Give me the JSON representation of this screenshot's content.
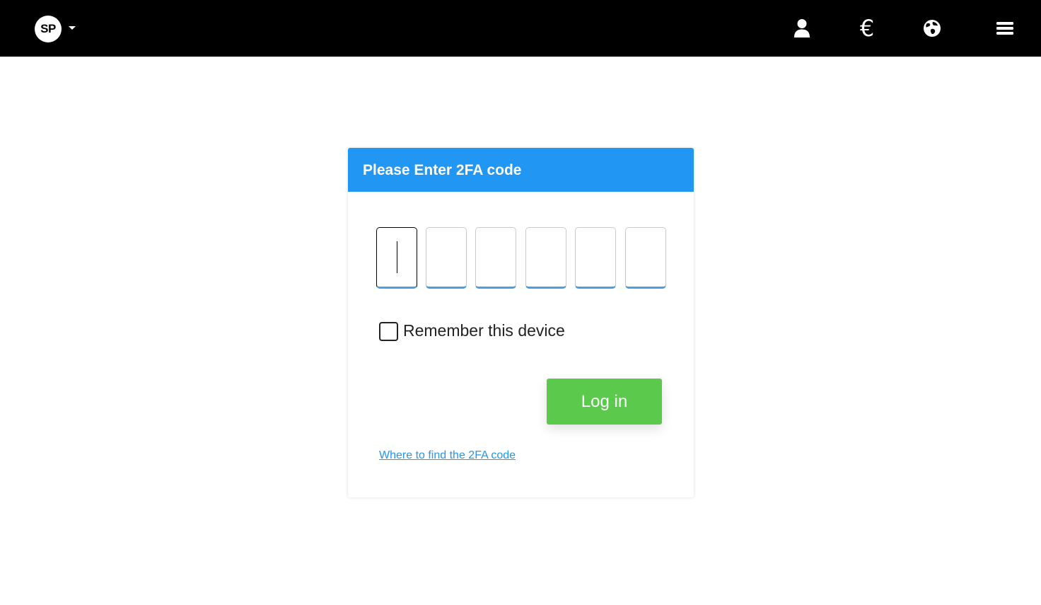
{
  "header": {
    "logo_text": "SP",
    "icons": [
      "user-icon",
      "euro-icon",
      "globe-icon",
      "hamburger-menu-icon"
    ],
    "euro_symbol": "€"
  },
  "card": {
    "title": "Please Enter 2FA code",
    "code_digits": [
      "",
      "",
      "",
      "",
      "",
      ""
    ],
    "remember_label": "Remember this device",
    "remember_checked": false,
    "login_label": "Log in",
    "help_link": "Where to find the 2FA code"
  },
  "colors": {
    "header_bg": "#000000",
    "card_header": "#2196f3",
    "login_button": "#5bc94c",
    "link": "#2196f3"
  }
}
